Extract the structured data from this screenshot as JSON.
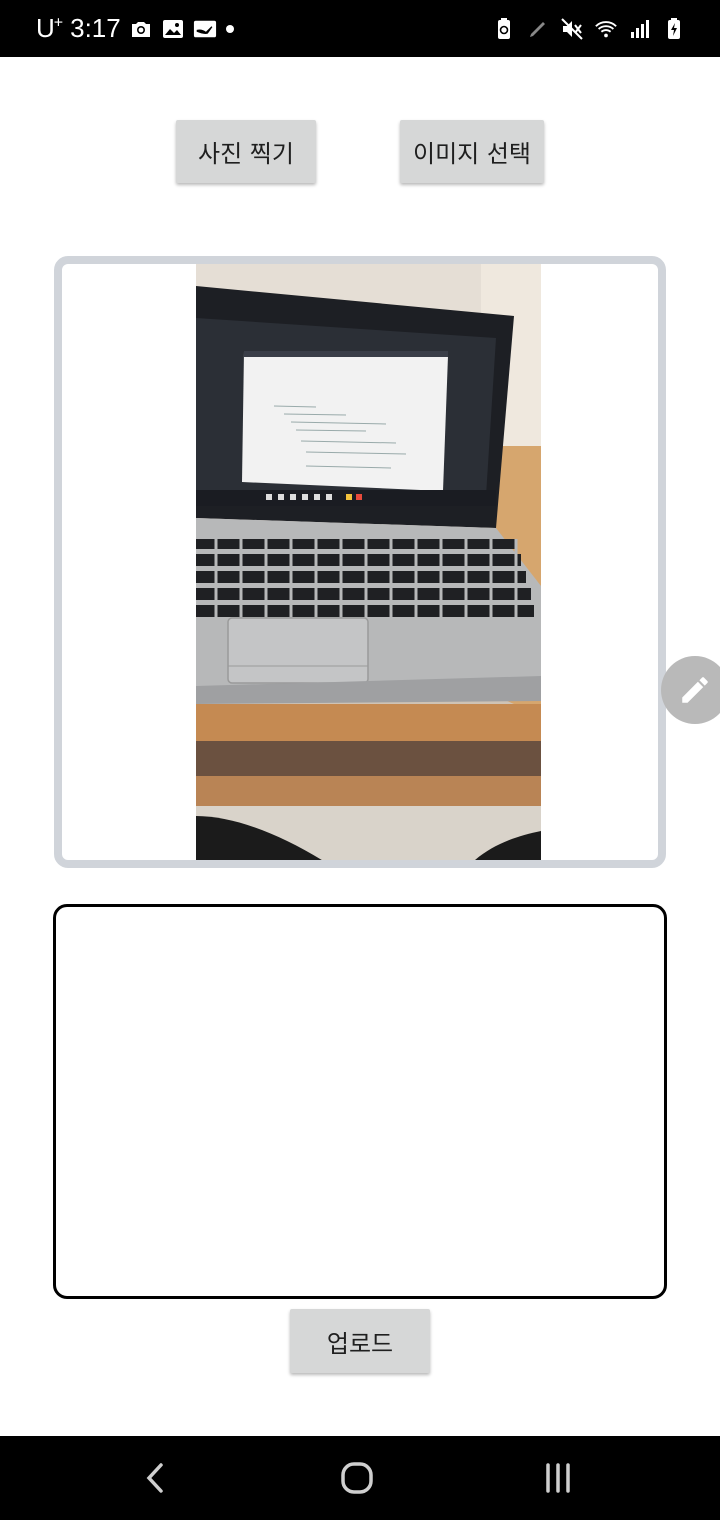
{
  "status_bar": {
    "carrier": "U",
    "carrier_sup": "+",
    "time": "3:17",
    "notification_icons": [
      "camera-icon",
      "gallery-icon",
      "app-notification-icon",
      "dot-icon"
    ],
    "system_icons": [
      "battery-saver-icon",
      "pen-icon",
      "mute-icon",
      "wifi-icon",
      "signal-icon",
      "battery-charging-icon"
    ]
  },
  "buttons": {
    "take_photo": "사진 찍기",
    "select_image": "이미지 선택",
    "upload": "업로드"
  },
  "preview": {
    "edit_icon": "pencil-icon"
  },
  "text_input": {
    "value": "",
    "placeholder": ""
  },
  "nav_bar": {
    "icons": [
      "back-icon",
      "home-icon",
      "recent-apps-icon"
    ]
  }
}
